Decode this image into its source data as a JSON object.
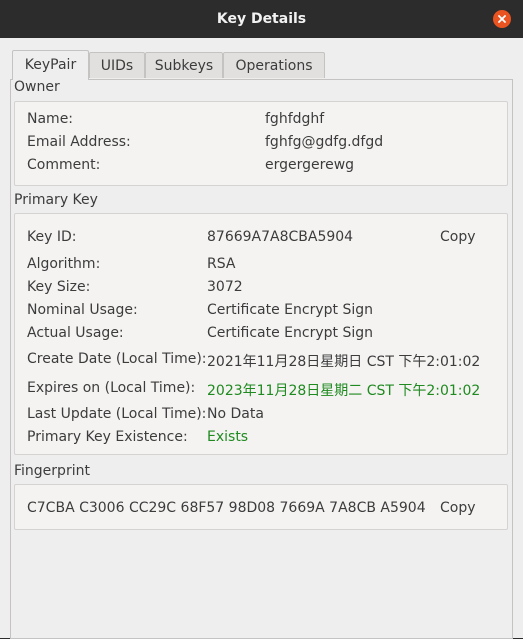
{
  "window": {
    "title": "Key Details"
  },
  "tabs": [
    "KeyPair",
    "UIDs",
    "Subkeys",
    "Operations"
  ],
  "owner": {
    "heading": "Owner",
    "name_label": "Name:",
    "name": "fghfdghf",
    "email_label": "Email Address:",
    "email": "fghfg@gdfg.dfgd",
    "comment_label": "Comment:",
    "comment": "ergergerewg"
  },
  "primary_key": {
    "heading": "Primary Key",
    "key_id_label": "Key ID:",
    "key_id": "87669A7A8CBA5904",
    "copy_label": "Copy",
    "algorithm_label": "Algorithm:",
    "algorithm": "RSA",
    "key_size_label": "Key Size:",
    "key_size": "3072",
    "nominal_usage_label": "Nominal Usage:",
    "nominal_usage": "Certificate Encrypt Sign",
    "actual_usage_label": "Actual Usage:",
    "actual_usage": "Certificate Encrypt Sign",
    "create_date_label": "Create Date (Local Time):",
    "create_date": "2021年11月28日星期日 CST 下午2:01:02",
    "expires_label": "Expires on (Local Time):",
    "expires": "2023年11月28日星期二 CST 下午2:01:02",
    "last_update_label": "Last Update (Local Time):",
    "last_update": "No Data",
    "existence_label": "Primary Key Existence:",
    "existence": "Exists"
  },
  "fingerprint": {
    "heading": "Fingerprint",
    "value": "C7CBA C3006 CC29C 68F57 98D08 7669A 7A8CB A5904",
    "copy_label": "Copy"
  },
  "colors": {
    "accent": "#e95420",
    "status_green": "#1f8a1f",
    "titlebar": "#2c2c2c"
  }
}
